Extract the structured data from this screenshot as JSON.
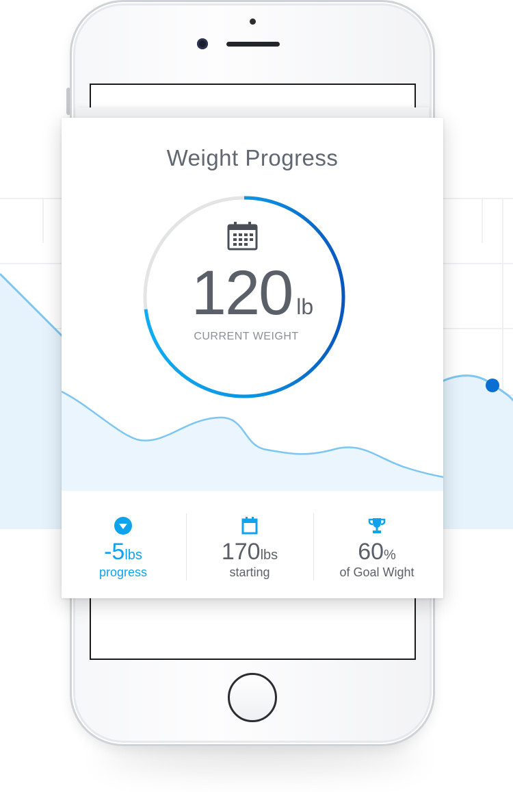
{
  "colors": {
    "accent": "#0ea3ec",
    "accent_dark": "#0a5fc4",
    "ring_track": "#e3e4e6",
    "text_dark": "#5b6068",
    "text_muted": "#8a8f96",
    "chart_line": "#7dc6f2",
    "chart_fill": "#e8f4fc"
  },
  "card": {
    "title": "Weight Progress",
    "ring_progress": 0.73
  },
  "current": {
    "value": "120",
    "unit": "lb",
    "label": "CURRENT WEIGHT",
    "icon": "calendar-icon"
  },
  "stats": [
    {
      "icon": "down-arrow-circle-icon",
      "value": "-5",
      "unit": "lbs",
      "label": "progress"
    },
    {
      "icon": "calendar-small-icon",
      "value": "170",
      "unit": "lbs",
      "label": "starting"
    },
    {
      "icon": "trophy-icon",
      "value": "60",
      "unit": "%",
      "label": "of Goal Wight"
    }
  ]
}
